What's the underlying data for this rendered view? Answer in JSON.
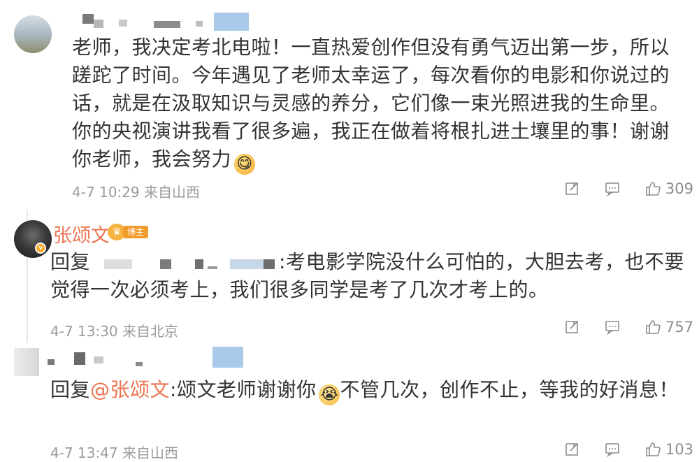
{
  "comments": [
    {
      "text": "老师，我决定考北电啦！一直热爱创作但没有勇气迈出第一步，所以蹉跎了时间。今年遇见了老师太幸运了，每次看你的电影和你说过的话，就是在汲取知识与灵感的养分，它们像一束光照进我的生命里。你的央视演讲我看了很多遍，我正在做着将根扎进土壤里的事！谢谢你老师，我会努力",
      "emoji": "drooling-face-emoji",
      "time": "4-7 10:29",
      "source": "来自山西",
      "likes": "309"
    },
    {
      "username": "张颂文",
      "badge": "博主",
      "reply_prefix": "回复",
      "text": ":考电影学院没什么可怕的，大胆去考，也不要觉得一次必须考上，我们很多同学是考了几次才考上的。",
      "time": "4-7 13:30",
      "source": "来自北京",
      "likes": "757"
    },
    {
      "reply_prefix": "回复",
      "mention": "@张颂文",
      "text_before": ":颂文老师谢谢你",
      "emoji": "crying-face-emoji",
      "text_after": "不管几次，创作不止，等我的好消息！",
      "time": "4-7 13:47",
      "source": "来自山西",
      "likes": "103"
    }
  ],
  "colors": {
    "accent": "#eb7350",
    "text": "#333333",
    "meta": "#9b9b9b",
    "icon": "#8c8c8c"
  },
  "icons": [
    "share-icon",
    "comment-icon",
    "like-icon"
  ]
}
